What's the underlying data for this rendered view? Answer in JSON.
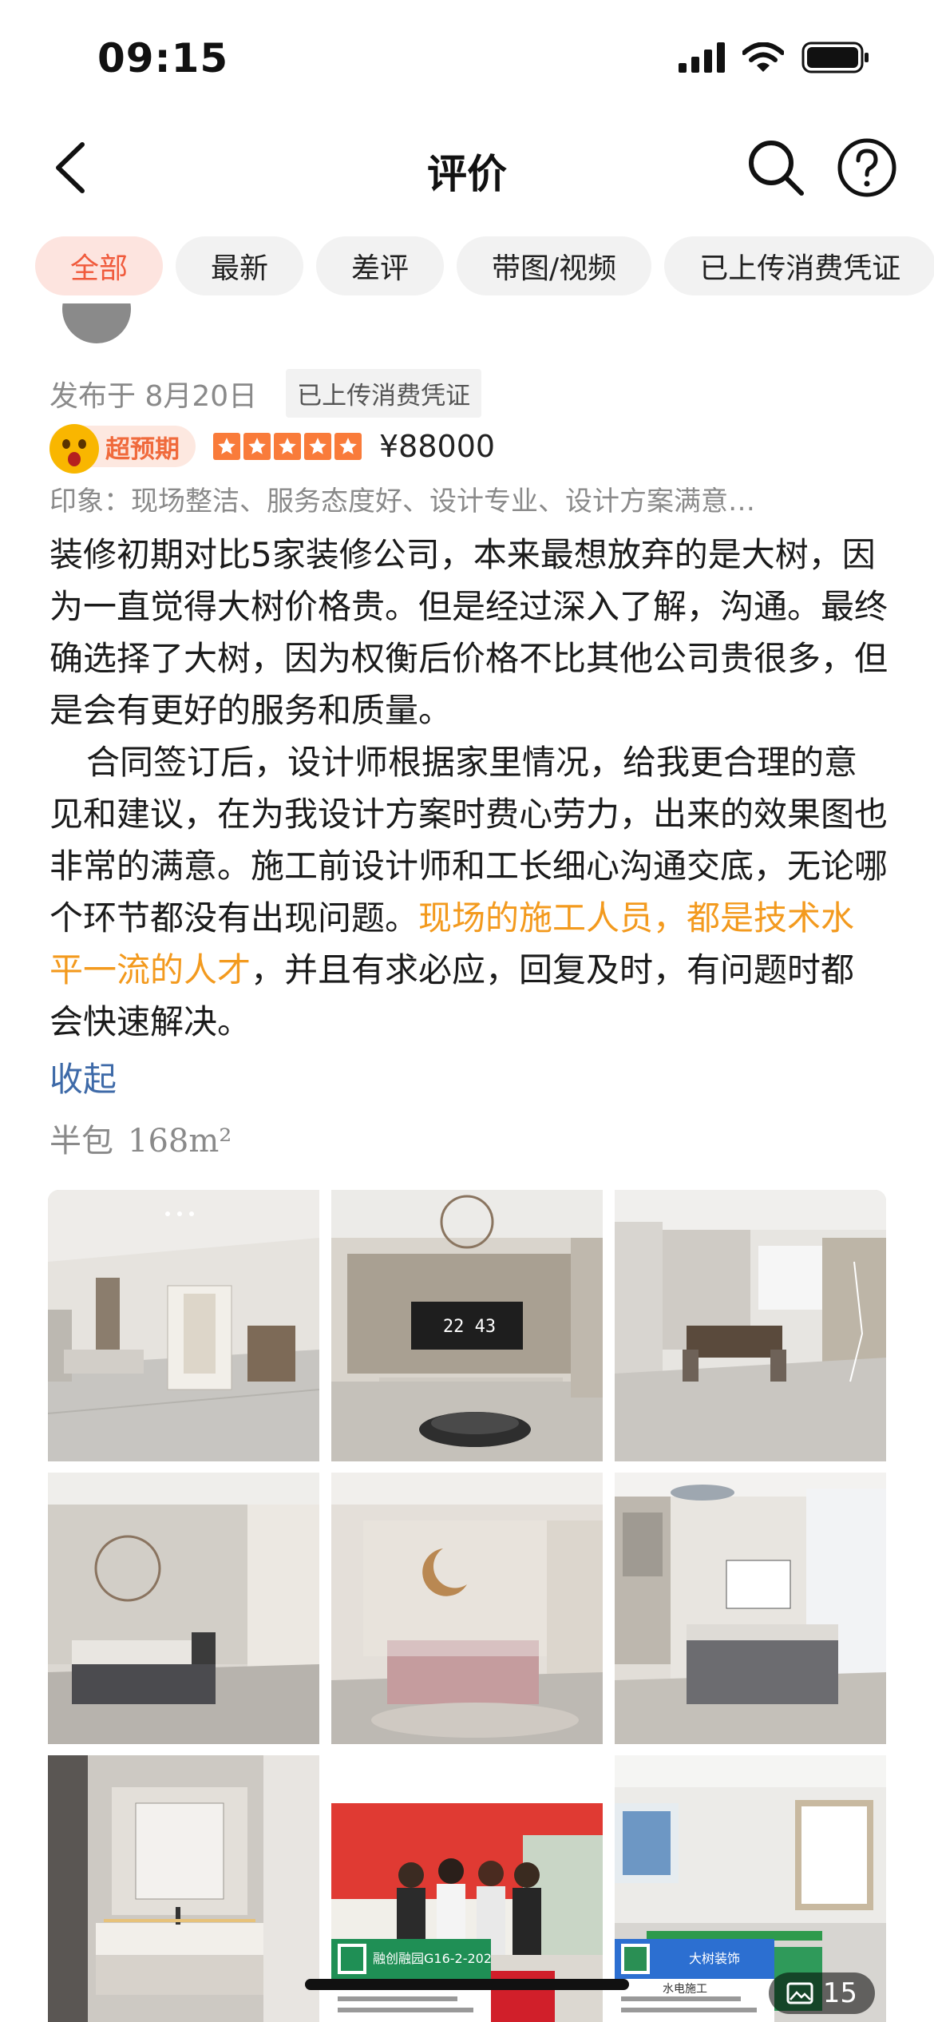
{
  "status": {
    "time": "09:15"
  },
  "nav": {
    "title": "评价"
  },
  "filters": [
    {
      "label": "全部",
      "active": true
    },
    {
      "label": "最新",
      "active": false
    },
    {
      "label": "差评",
      "active": false
    },
    {
      "label": "带图/视频",
      "active": false
    },
    {
      "label": "已上传消费凭证",
      "active": false
    }
  ],
  "review": {
    "publish_date": "发布于 8月20日",
    "voucher_tag": "已上传消费凭证",
    "badge": "超预期",
    "stars": 5,
    "price": "¥88000",
    "impression": "印象：现场整洁、服务态度好、设计专业、设计方案满意…",
    "para1": "装修初期对比5家装修公司，本来最想放弃的是大树，因为一直觉得大树价格贵。但是经过深入了解，沟通。最终确选择了大树，因为权衡后价格不比其他公司贵很多，但是会有更好的服务和质量。",
    "para2_a": "合同签订后，设计师根据家里情况，给我更合理的意见和建议，在为我设计方案时费心劳力，出来的效果图也非常的满意。施工前设计师和工长细心沟通交底，无论哪个环节都没有出现问题。",
    "para2_highlight": "现场的施工人员，都是技术水平一流的人才",
    "para2_b": "，并且有求必应，回复及时，有问题时都会快速解决。",
    "collapse": "收起",
    "package": "半包",
    "area": "168m²"
  },
  "photos": {
    "count": "15",
    "tv_clock": "22 43",
    "tag_left": "融创融园G16-2-202",
    "tag_right": "大树装饰",
    "tag_right_sub": "水电施工"
  },
  "colors": {
    "accent": "#f05a3c",
    "highlight": "#f39a1e",
    "link": "#3e6aa8",
    "star": "#f97b3a"
  }
}
